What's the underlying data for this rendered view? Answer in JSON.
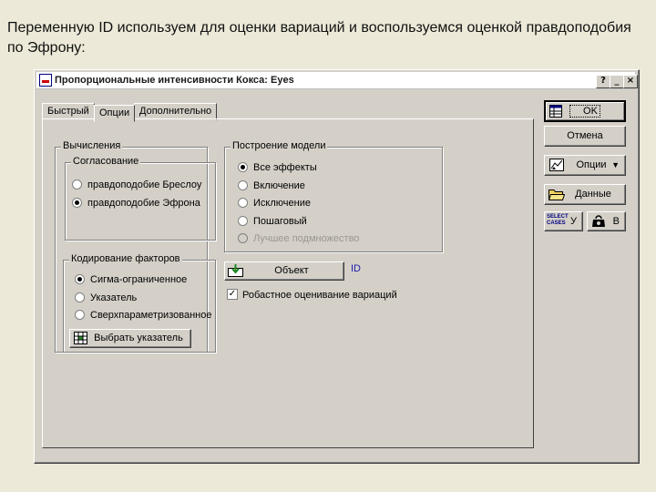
{
  "caption": "Переменную ID используем для оценки вариаций и воспользуемся оценкой правдоподобия по Эфрону:",
  "window": {
    "title": "Пропорциональные интенсивности Кокса: Eyes"
  },
  "titlebar_buttons": {
    "help": "?",
    "minimize": "_",
    "close": "×"
  },
  "tabs": [
    "Быстрый",
    "Опции",
    "Дополнительно"
  ],
  "active_tab": "Опции",
  "calculations": {
    "title": "Вычисления",
    "agreement": {
      "title": "Согласование",
      "options": [
        "правдоподобие Бреслоу",
        "правдоподобие Эфрона"
      ],
      "selected": "правдоподобие Эфрона"
    }
  },
  "factor_coding": {
    "title": "Кодирование факторов",
    "options": [
      "Сигма-ограниченное",
      "Указатель",
      "Сверхпараметризованное"
    ],
    "selected": "Сигма-ограниченное",
    "select_indicator_button": "Выбрать указатель"
  },
  "model_building": {
    "title": "Построение модели",
    "options": [
      "Все эффекты",
      "Включение",
      "Исключение",
      "Пошаговый",
      "Лучшее подмножество"
    ],
    "selected": "Все эффекты",
    "disabled": [
      "Лучшее подмножество"
    ]
  },
  "object": {
    "button_label": "Объект",
    "value": "ID"
  },
  "robust_checkbox": {
    "label": "Робастное оценивание вариаций",
    "checked": true
  },
  "side_buttons": {
    "ok": "OK",
    "cancel": "Отмена",
    "options": "Опции",
    "data": "Данные",
    "select_cases_icon_text": "SELECT CASES",
    "select_cases_label": "У",
    "weight_label": "В"
  }
}
